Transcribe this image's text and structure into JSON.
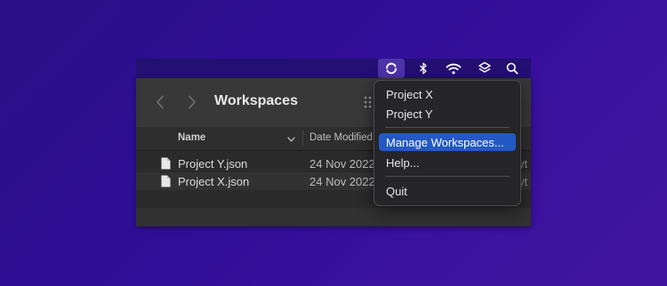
{
  "menubar": {
    "icons": [
      "sync-icon",
      "bluetooth-icon",
      "wifi-icon",
      "layers-icon",
      "search-icon"
    ]
  },
  "finder": {
    "title": "Workspaces",
    "columns": {
      "name": "Name",
      "date": "Date Modified"
    },
    "files": [
      {
        "name": "Project Y.json",
        "date": "24 Nov 2022",
        "kind": "yt"
      },
      {
        "name": "Project X.json",
        "date": "24 Nov 2022",
        "kind": "yt"
      }
    ]
  },
  "menu": {
    "items": [
      {
        "label": "Project X"
      },
      {
        "label": "Project Y"
      },
      {
        "label": "Manage Workspaces..."
      },
      {
        "label": "Help..."
      },
      {
        "label": "Quit"
      }
    ],
    "highlight_color": "#2458c4"
  }
}
